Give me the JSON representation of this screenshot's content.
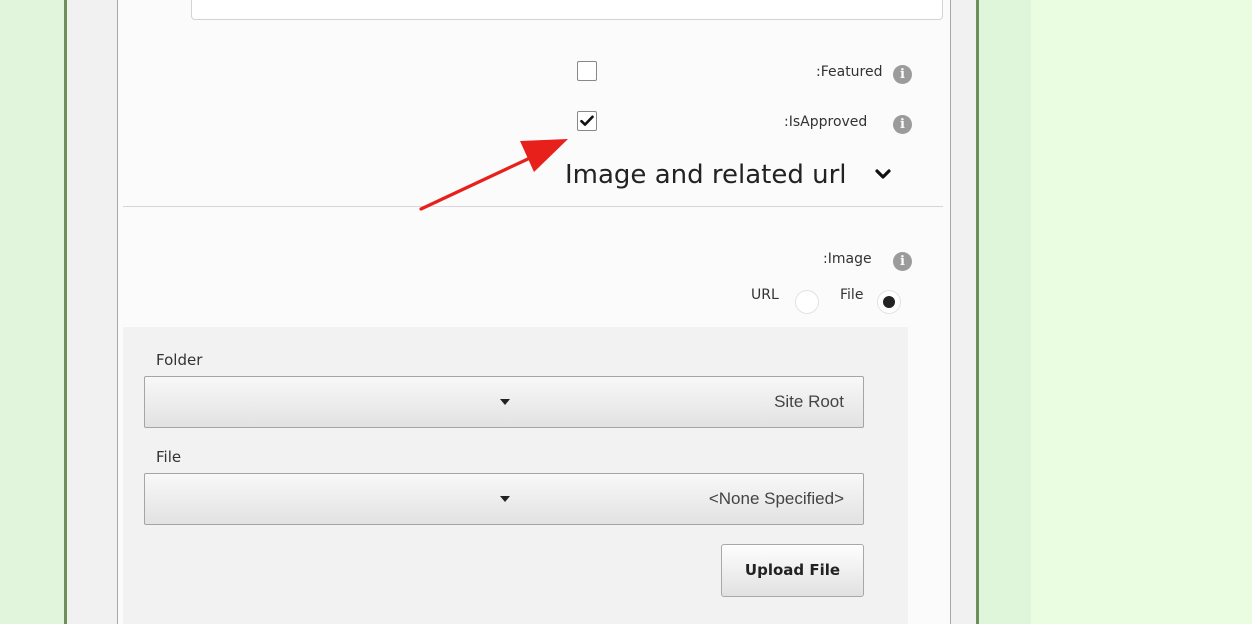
{
  "options": {
    "featured": {
      "label": ":Featured",
      "checked": false
    },
    "is_approved": {
      "label": ":IsApproved",
      "checked": true
    }
  },
  "section": {
    "title": "Image and related url"
  },
  "image": {
    "label": ":Image",
    "url_option": "URL",
    "file_option": "File",
    "selected": "File"
  },
  "folder": {
    "label": "Folder",
    "value": "Site Root"
  },
  "file": {
    "label": "File",
    "value": "<None Specified>"
  },
  "upload_button": "Upload File",
  "icons": {
    "info": "info-icon",
    "chevron": "chevron-down-icon",
    "check": "check-icon",
    "dropdown": "caret-down-icon",
    "annotation": "red-arrow-annotation"
  },
  "colors": {
    "page_background": "#e8fde0",
    "panel_border": "#6e8e5c",
    "annotation_arrow": "#e8201c"
  }
}
